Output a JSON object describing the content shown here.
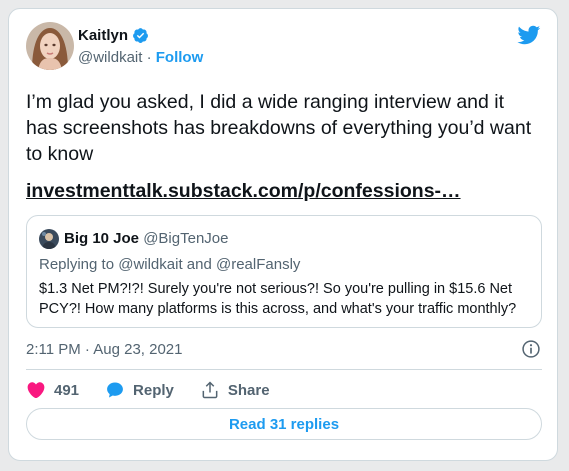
{
  "author": {
    "name": "Kaitlyn",
    "handle": "@wildkait",
    "separator": "·",
    "follow_label": "Follow",
    "verified": true
  },
  "tweet": {
    "text": "I’m glad you asked, I did a wide ranging interview and it has screenshots has breakdowns of everything you’d want to know",
    "link": "investmenttalk.substack.com/p/confessions-…",
    "timestamp": "2:11 PM · Aug 23, 2021"
  },
  "quoted": {
    "name": "Big 10 Joe",
    "handle": "@BigTenJoe",
    "replying_to": "Replying to @wildkait and @realFansly",
    "text": "$1.3 Net PM?!?! Surely you're not serious?! So you're pulling in $15.6 Net PCY?! How many platforms is this across, and what's your traffic monthly?"
  },
  "actions": {
    "likes": "491",
    "reply_label": "Reply",
    "share_label": "Share"
  },
  "read_replies_label": "Read 31 replies",
  "colors": {
    "accent": "#1d9bf0",
    "like": "#f91880",
    "text": "#0f1419",
    "secondary": "#536471",
    "border": "#cfd9de"
  },
  "icons": [
    "verified-badge-icon",
    "twitter-bird-icon",
    "info-icon",
    "heart-icon",
    "reply-bubble-icon",
    "share-icon"
  ]
}
